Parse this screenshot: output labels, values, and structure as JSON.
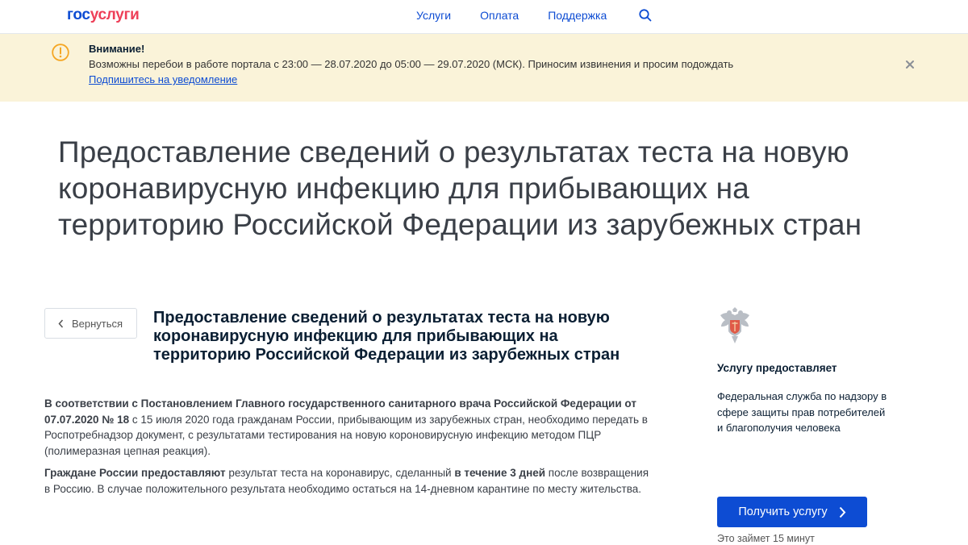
{
  "header": {
    "logo_part1": "гос",
    "logo_part2": "услуги",
    "nav": [
      "Услуги",
      "Оплата",
      "Поддержка"
    ]
  },
  "alert": {
    "title": "Внимание!",
    "text": "Возможны перебои в работе портала с 23:00 — 28.07.2020 до 05:00 — 29.07.2020 (МСК). Приносим извинения и просим подождать",
    "link": "Подпишитесь на уведомление"
  },
  "page": {
    "title": "Предоставление сведений о результатах теста на новую коронавирусную инфекцию для прибывающих на территорию Российской Федерации из зарубежных стран",
    "back_label": "Вернуться",
    "section_title": "Предоставление сведений о результатах теста на новую коронавирусную инфекцию для прибывающих на территорию Российской Федерации из зарубежных стран"
  },
  "body": {
    "p1_bold": "В соответствии с Постановлением Главного государственного санитарного врача Российской Федерации от 07.07.2020 № 18",
    "p1_rest": " с 15 июля 2020 года гражданам России, прибывающим из зарубежных стран, необходимо передать в Роспотребнадзор документ, с результатами тестирования на новую короновирусную инфекцию методом ПЦР (полимеразная цепная реакция).",
    "p2_bold1": "Граждане России предоставляют",
    "p2_mid": " результат теста на коронавирус, сделанный ",
    "p2_bold2": "в течение 3 дней",
    "p2_rest": " после возвращения в Россию. В случае положительного результата необходимо остаться на 14-дневном карантине по месту жительства."
  },
  "sidebar": {
    "provider_heading": "Услугу предоставляет",
    "provider_name": "Федеральная служба по надзору в сфере защиты прав потребителей и благополучия человека",
    "button_label": "Получить услугу",
    "duration": "Это займет 15 минут"
  },
  "colors": {
    "brand_blue": "#0d4cd3",
    "brand_red": "#ee3f58",
    "alert_bg": "#faf3d9",
    "alert_icon": "#f5a623"
  }
}
